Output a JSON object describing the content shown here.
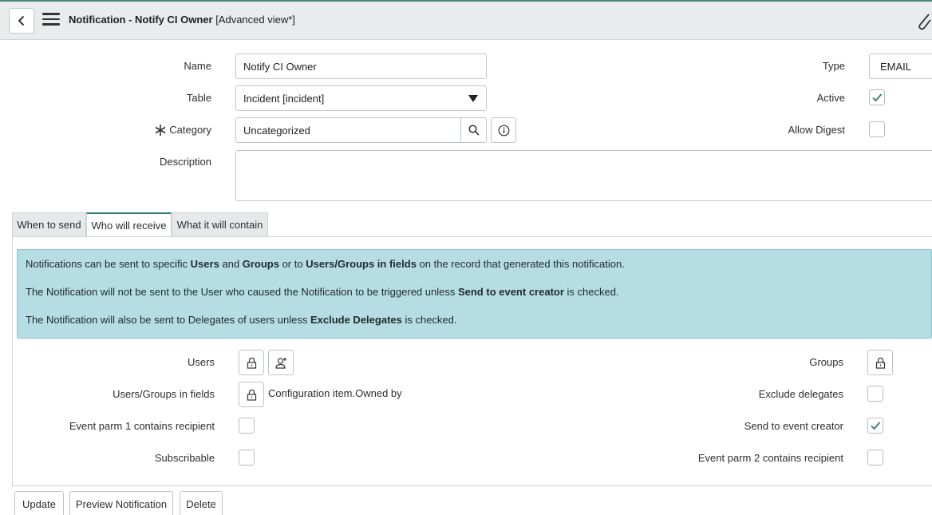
{
  "header": {
    "title_main": "Notification - Notify CI Owner",
    "title_view": "[Advanced view*]"
  },
  "form": {
    "name": {
      "label": "Name",
      "value": "Notify CI Owner"
    },
    "table": {
      "label": "Table",
      "value": "Incident [incident]"
    },
    "category": {
      "label": "Category",
      "value": "Uncategorized"
    },
    "description": {
      "label": "Description",
      "value": ""
    },
    "type": {
      "label": "Type",
      "value": "EMAIL"
    },
    "active": {
      "label": "Active",
      "checked": true
    },
    "allow_digest": {
      "label": "Allow Digest",
      "checked": false
    }
  },
  "tabs": [
    {
      "label": "When to send",
      "active": false
    },
    {
      "label": "Who will receive",
      "active": true
    },
    {
      "label": "What it will contain",
      "active": false
    }
  ],
  "info": {
    "p1": {
      "a": "Notifications can be sent to specific ",
      "b1": "Users",
      "c": " and ",
      "b2": "Groups",
      "d": " or to ",
      "b3": "Users/Groups in fields",
      "e": " on the record that generated this notification."
    },
    "p2": {
      "a": "The Notification will not be sent to the User who caused the Notification to be triggered unless ",
      "b1": "Send to event creator",
      "c": " is checked."
    },
    "p3": {
      "a": "The Notification will also be sent to Delegates of users unless ",
      "b1": "Exclude Delegates",
      "c": " is checked."
    }
  },
  "recipients": {
    "users": {
      "label": "Users"
    },
    "groups": {
      "label": "Groups"
    },
    "users_groups_fields": {
      "label": "Users/Groups in fields",
      "value": "Configuration item.Owned by"
    },
    "exclude_delegates": {
      "label": "Exclude delegates",
      "checked": false
    },
    "event_parm1": {
      "label": "Event parm 1 contains recipient",
      "checked": false
    },
    "send_to_event_creator": {
      "label": "Send to event creator",
      "checked": true
    },
    "subscribable": {
      "label": "Subscribable",
      "checked": false
    },
    "event_parm2": {
      "label": "Event parm 2 contains recipient",
      "checked": false
    }
  },
  "buttons": {
    "update": "Update",
    "preview": "Preview Notification",
    "delete": "Delete"
  },
  "colors": {
    "accent": "#2f7f6f",
    "info_bg": "#b5dde3",
    "header_bg": "#e9ebed"
  }
}
